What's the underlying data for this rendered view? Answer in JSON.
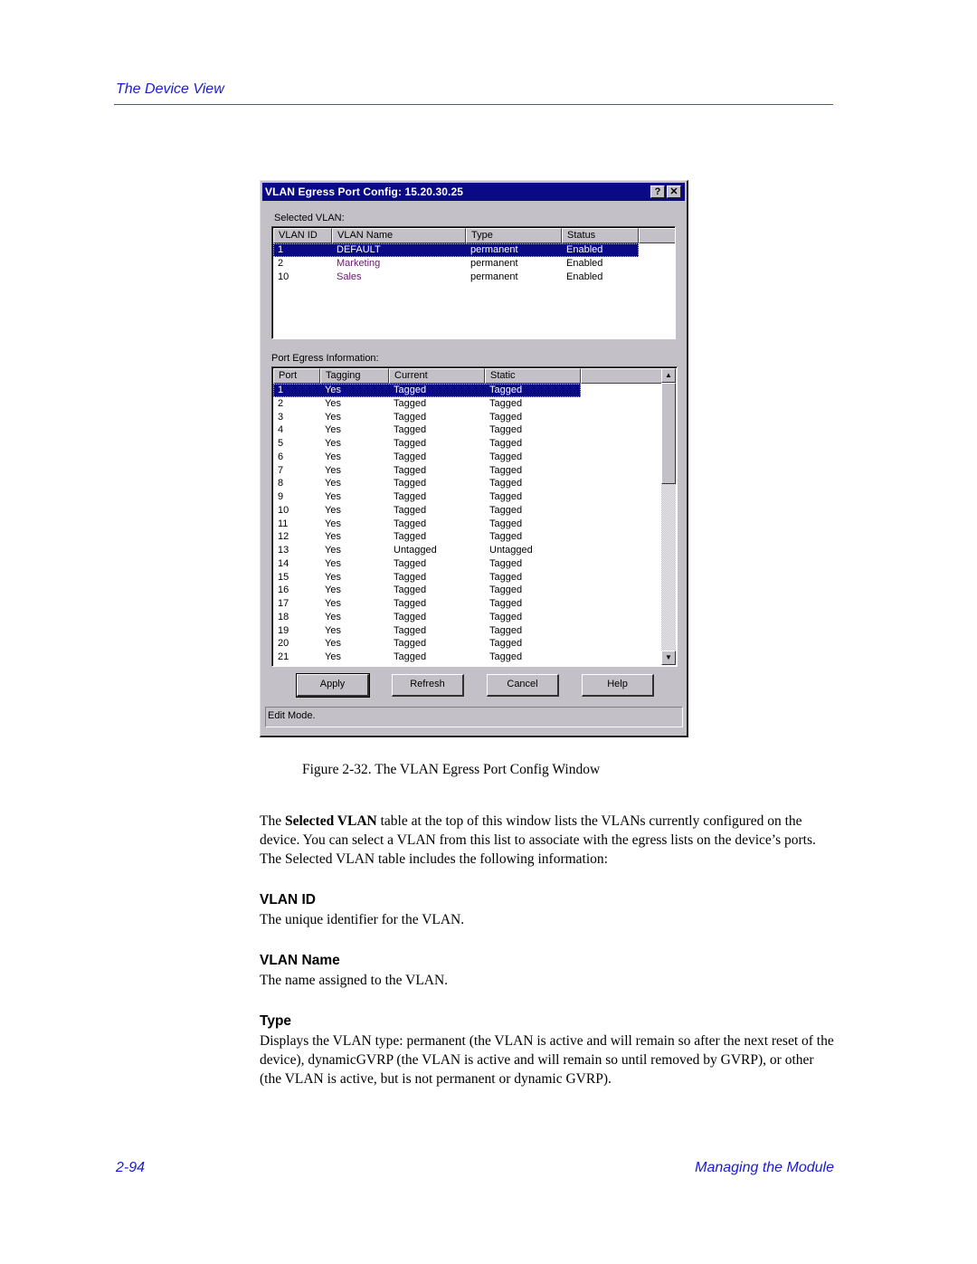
{
  "page": {
    "running_header": "The Device View",
    "footer_page_number": "2-94",
    "footer_chapter": "Managing the Module"
  },
  "dialog": {
    "title": "VLAN Egress Port Config: 15.20.30.25",
    "help_icon": "?",
    "close_icon": "✕",
    "selected_vlan_label": "Selected VLAN:",
    "vlan_table": {
      "headers": [
        "VLAN ID",
        "VLAN Name",
        "Type",
        "Status"
      ],
      "rows": [
        {
          "id": "1",
          "name": "DEFAULT",
          "type": "permanent",
          "status": "Enabled",
          "selected": true
        },
        {
          "id": "2",
          "name": "Marketing",
          "type": "permanent",
          "status": "Enabled",
          "selected": false
        },
        {
          "id": "10",
          "name": "Sales",
          "type": "permanent",
          "status": "Enabled",
          "selected": false
        }
      ]
    },
    "port_egress_label": "Port Egress Information:",
    "port_table": {
      "headers": [
        "Port",
        "Tagging",
        "Current",
        "Static"
      ],
      "rows": [
        {
          "port": "1",
          "tagging": "Yes",
          "current": "Tagged",
          "static": "Tagged",
          "selected": true
        },
        {
          "port": "2",
          "tagging": "Yes",
          "current": "Tagged",
          "static": "Tagged"
        },
        {
          "port": "3",
          "tagging": "Yes",
          "current": "Tagged",
          "static": "Tagged"
        },
        {
          "port": "4",
          "tagging": "Yes",
          "current": "Tagged",
          "static": "Tagged"
        },
        {
          "port": "5",
          "tagging": "Yes",
          "current": "Tagged",
          "static": "Tagged"
        },
        {
          "port": "6",
          "tagging": "Yes",
          "current": "Tagged",
          "static": "Tagged"
        },
        {
          "port": "7",
          "tagging": "Yes",
          "current": "Tagged",
          "static": "Tagged"
        },
        {
          "port": "8",
          "tagging": "Yes",
          "current": "Tagged",
          "static": "Tagged"
        },
        {
          "port": "9",
          "tagging": "Yes",
          "current": "Tagged",
          "static": "Tagged"
        },
        {
          "port": "10",
          "tagging": "Yes",
          "current": "Tagged",
          "static": "Tagged"
        },
        {
          "port": "11",
          "tagging": "Yes",
          "current": "Tagged",
          "static": "Tagged"
        },
        {
          "port": "12",
          "tagging": "Yes",
          "current": "Tagged",
          "static": "Tagged"
        },
        {
          "port": "13",
          "tagging": "Yes",
          "current": "Untagged",
          "static": "Untagged"
        },
        {
          "port": "14",
          "tagging": "Yes",
          "current": "Tagged",
          "static": "Tagged"
        },
        {
          "port": "15",
          "tagging": "Yes",
          "current": "Tagged",
          "static": "Tagged"
        },
        {
          "port": "16",
          "tagging": "Yes",
          "current": "Tagged",
          "static": "Tagged"
        },
        {
          "port": "17",
          "tagging": "Yes",
          "current": "Tagged",
          "static": "Tagged"
        },
        {
          "port": "18",
          "tagging": "Yes",
          "current": "Tagged",
          "static": "Tagged"
        },
        {
          "port": "19",
          "tagging": "Yes",
          "current": "Tagged",
          "static": "Tagged"
        },
        {
          "port": "20",
          "tagging": "Yes",
          "current": "Tagged",
          "static": "Tagged"
        },
        {
          "port": "21",
          "tagging": "Yes",
          "current": "Tagged",
          "static": "Tagged"
        }
      ]
    },
    "scroll_up_icon": "▲",
    "scroll_down_icon": "▼",
    "buttons": {
      "apply": "Apply",
      "refresh": "Refresh",
      "cancel": "Cancel",
      "help": "Help"
    },
    "status_text": "Edit Mode."
  },
  "document": {
    "caption": "Figure 2-32.  The VLAN Egress Port Config Window",
    "intro_bold": "Selected VLAN",
    "intro_pre": "The ",
    "intro_post": " table at the top of this window lists the VLANs currently configured on the device. You can select a VLAN from this list to associate with the egress lists on the device’s ports. The Selected VLAN table includes the following information:",
    "sections": [
      {
        "heading": "VLAN ID",
        "body": "The unique identifier for the VLAN."
      },
      {
        "heading": "VLAN Name",
        "body": "The name assigned to the VLAN."
      },
      {
        "heading": "Type",
        "body": "Displays the VLAN type: permanent (the VLAN is active and will remain so after the next reset of the device), dynamicGVRP (the VLAN is active and will remain so until removed by GVRP), or other (the VLAN is active, but is not permanent or dynamic GVRP)."
      }
    ]
  }
}
